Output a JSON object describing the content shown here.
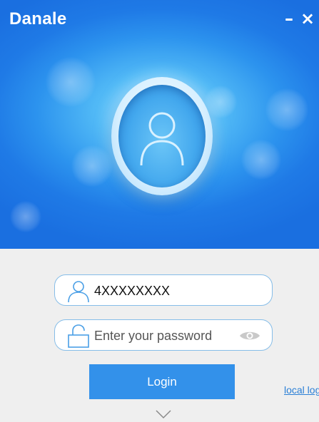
{
  "app": {
    "title": "Danale",
    "minimize_glyph": "–",
    "close_glyph": "×"
  },
  "avatar": {
    "icon": "user-avatar-icon"
  },
  "login_form": {
    "username": {
      "icon": "user-icon",
      "value": "4XXXXXXXX"
    },
    "password": {
      "icon": "lock-icon",
      "placeholder": "Enter your password",
      "visibility_icon": "eye-icon"
    },
    "login_label": "Login",
    "local_login_label": "local log",
    "expand_icon": "chevron-down-icon"
  },
  "colors": {
    "accent": "#3391ea",
    "header_blue": "#2c93ee",
    "field_border": "#86bde8",
    "link": "#2a7fd6"
  }
}
